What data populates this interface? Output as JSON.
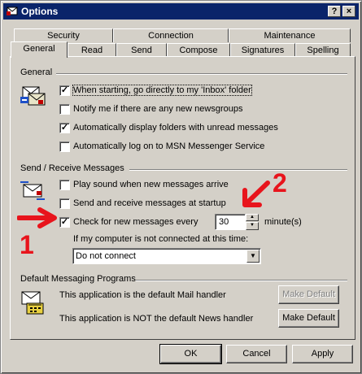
{
  "window": {
    "title": "Options"
  },
  "titlebar_buttons": {
    "help": "?",
    "close": "×"
  },
  "tabs_top": [
    "Security",
    "Connection",
    "Maintenance"
  ],
  "tabs_bottom": [
    "General",
    "Read",
    "Send",
    "Compose",
    "Signatures",
    "Spelling"
  ],
  "general": {
    "heading": "General",
    "options": [
      {
        "label": "When starting, go directly to my 'Inbox' folder",
        "checked": true
      },
      {
        "label": "Notify me if there are any new newsgroups",
        "checked": false
      },
      {
        "label": "Automatically display folders with unread messages",
        "checked": true
      },
      {
        "label": "Automatically log on to MSN Messenger Service",
        "checked": false
      }
    ]
  },
  "send_receive": {
    "heading": "Send / Receive Messages",
    "options": [
      {
        "label": "Play sound when new messages arrive",
        "checked": false
      },
      {
        "label": "Send and receive messages at startup",
        "checked": false
      },
      {
        "label": "Check for new messages every",
        "checked": true
      }
    ],
    "interval_value": "30",
    "interval_unit": "minute(s)",
    "not_connected_label": "If my computer is not connected at this time:",
    "not_connected_selected": "Do not connect"
  },
  "default_programs": {
    "heading": "Default Messaging Programs",
    "mail_text": "This application is the default Mail handler",
    "news_text": "This application is NOT the default News handler",
    "make_default_label": "Make Default"
  },
  "footer": {
    "ok": "OK",
    "cancel": "Cancel",
    "apply": "Apply"
  },
  "annotations": {
    "one": "1",
    "two": "2"
  },
  "colors": {
    "titlebar": "#0a246a",
    "dialog": "#d4d0c8",
    "annotation": "#e8141c"
  }
}
